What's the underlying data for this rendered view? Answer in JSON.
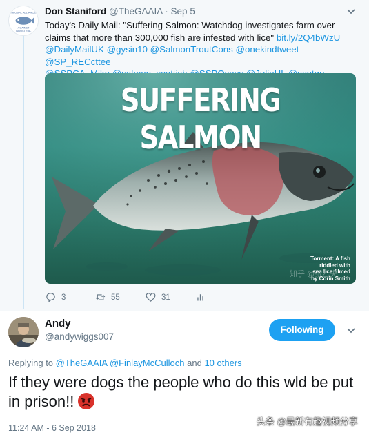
{
  "tweet": {
    "author_name": "Don Staniford",
    "author_handle": "@TheGAAIA",
    "separator": "·",
    "date": "Sep 5",
    "text_intro": "Today's Daily Mail: \"Suffering Salmon: Watchdog investigates farm over claims that more than 300,000 fish are infested with lice\"",
    "text_link": "bit.ly/2Q4bWzU",
    "mentions_line1": "@DailyMailUK @gysin10 @SalmonTroutCons @onekindtweet @SP_RECcttee",
    "mentions_line2": "@SSPCA_Mike @salmon_scottish @SSPOsays @JulieHL @scotgp",
    "media": {
      "headline": "SUFFERING SALMON",
      "caption_line1": "Torment: A fish",
      "caption_line2": "riddled with",
      "caption_line3": "sea lice filmed",
      "caption_line4": "by Corin Smith",
      "watermark": "知乎 @张乙夫"
    },
    "actions": {
      "reply_count": "3",
      "retweet_count": "55",
      "like_count": "31",
      "icons": [
        "reply-icon",
        "retweet-icon",
        "heart-icon",
        "analytics-icon"
      ]
    }
  },
  "reply": {
    "author_name": "Andy",
    "author_handle": "@andywiggs007",
    "follow_label": "Following",
    "replying_prefix": "Replying to",
    "replying_user1": "@TheGAAIA",
    "replying_user2": "@FinlayMcCulloch",
    "replying_suffix_and": "and",
    "replying_others": "10 others",
    "text": "If they were dogs the people who do this wld be put in prison!!",
    "emoji": "angry-face-emoji",
    "timestamp": "11:24 AM - 6 Sep 2018"
  },
  "watermark": "头条 @最新有趣视频分享",
  "colors": {
    "link": "#1b95e0",
    "follow_button": "#1da1f2",
    "muted": "#657786",
    "thread_line": "#cce4f4",
    "tweet_bg": "#f5f8fa"
  }
}
